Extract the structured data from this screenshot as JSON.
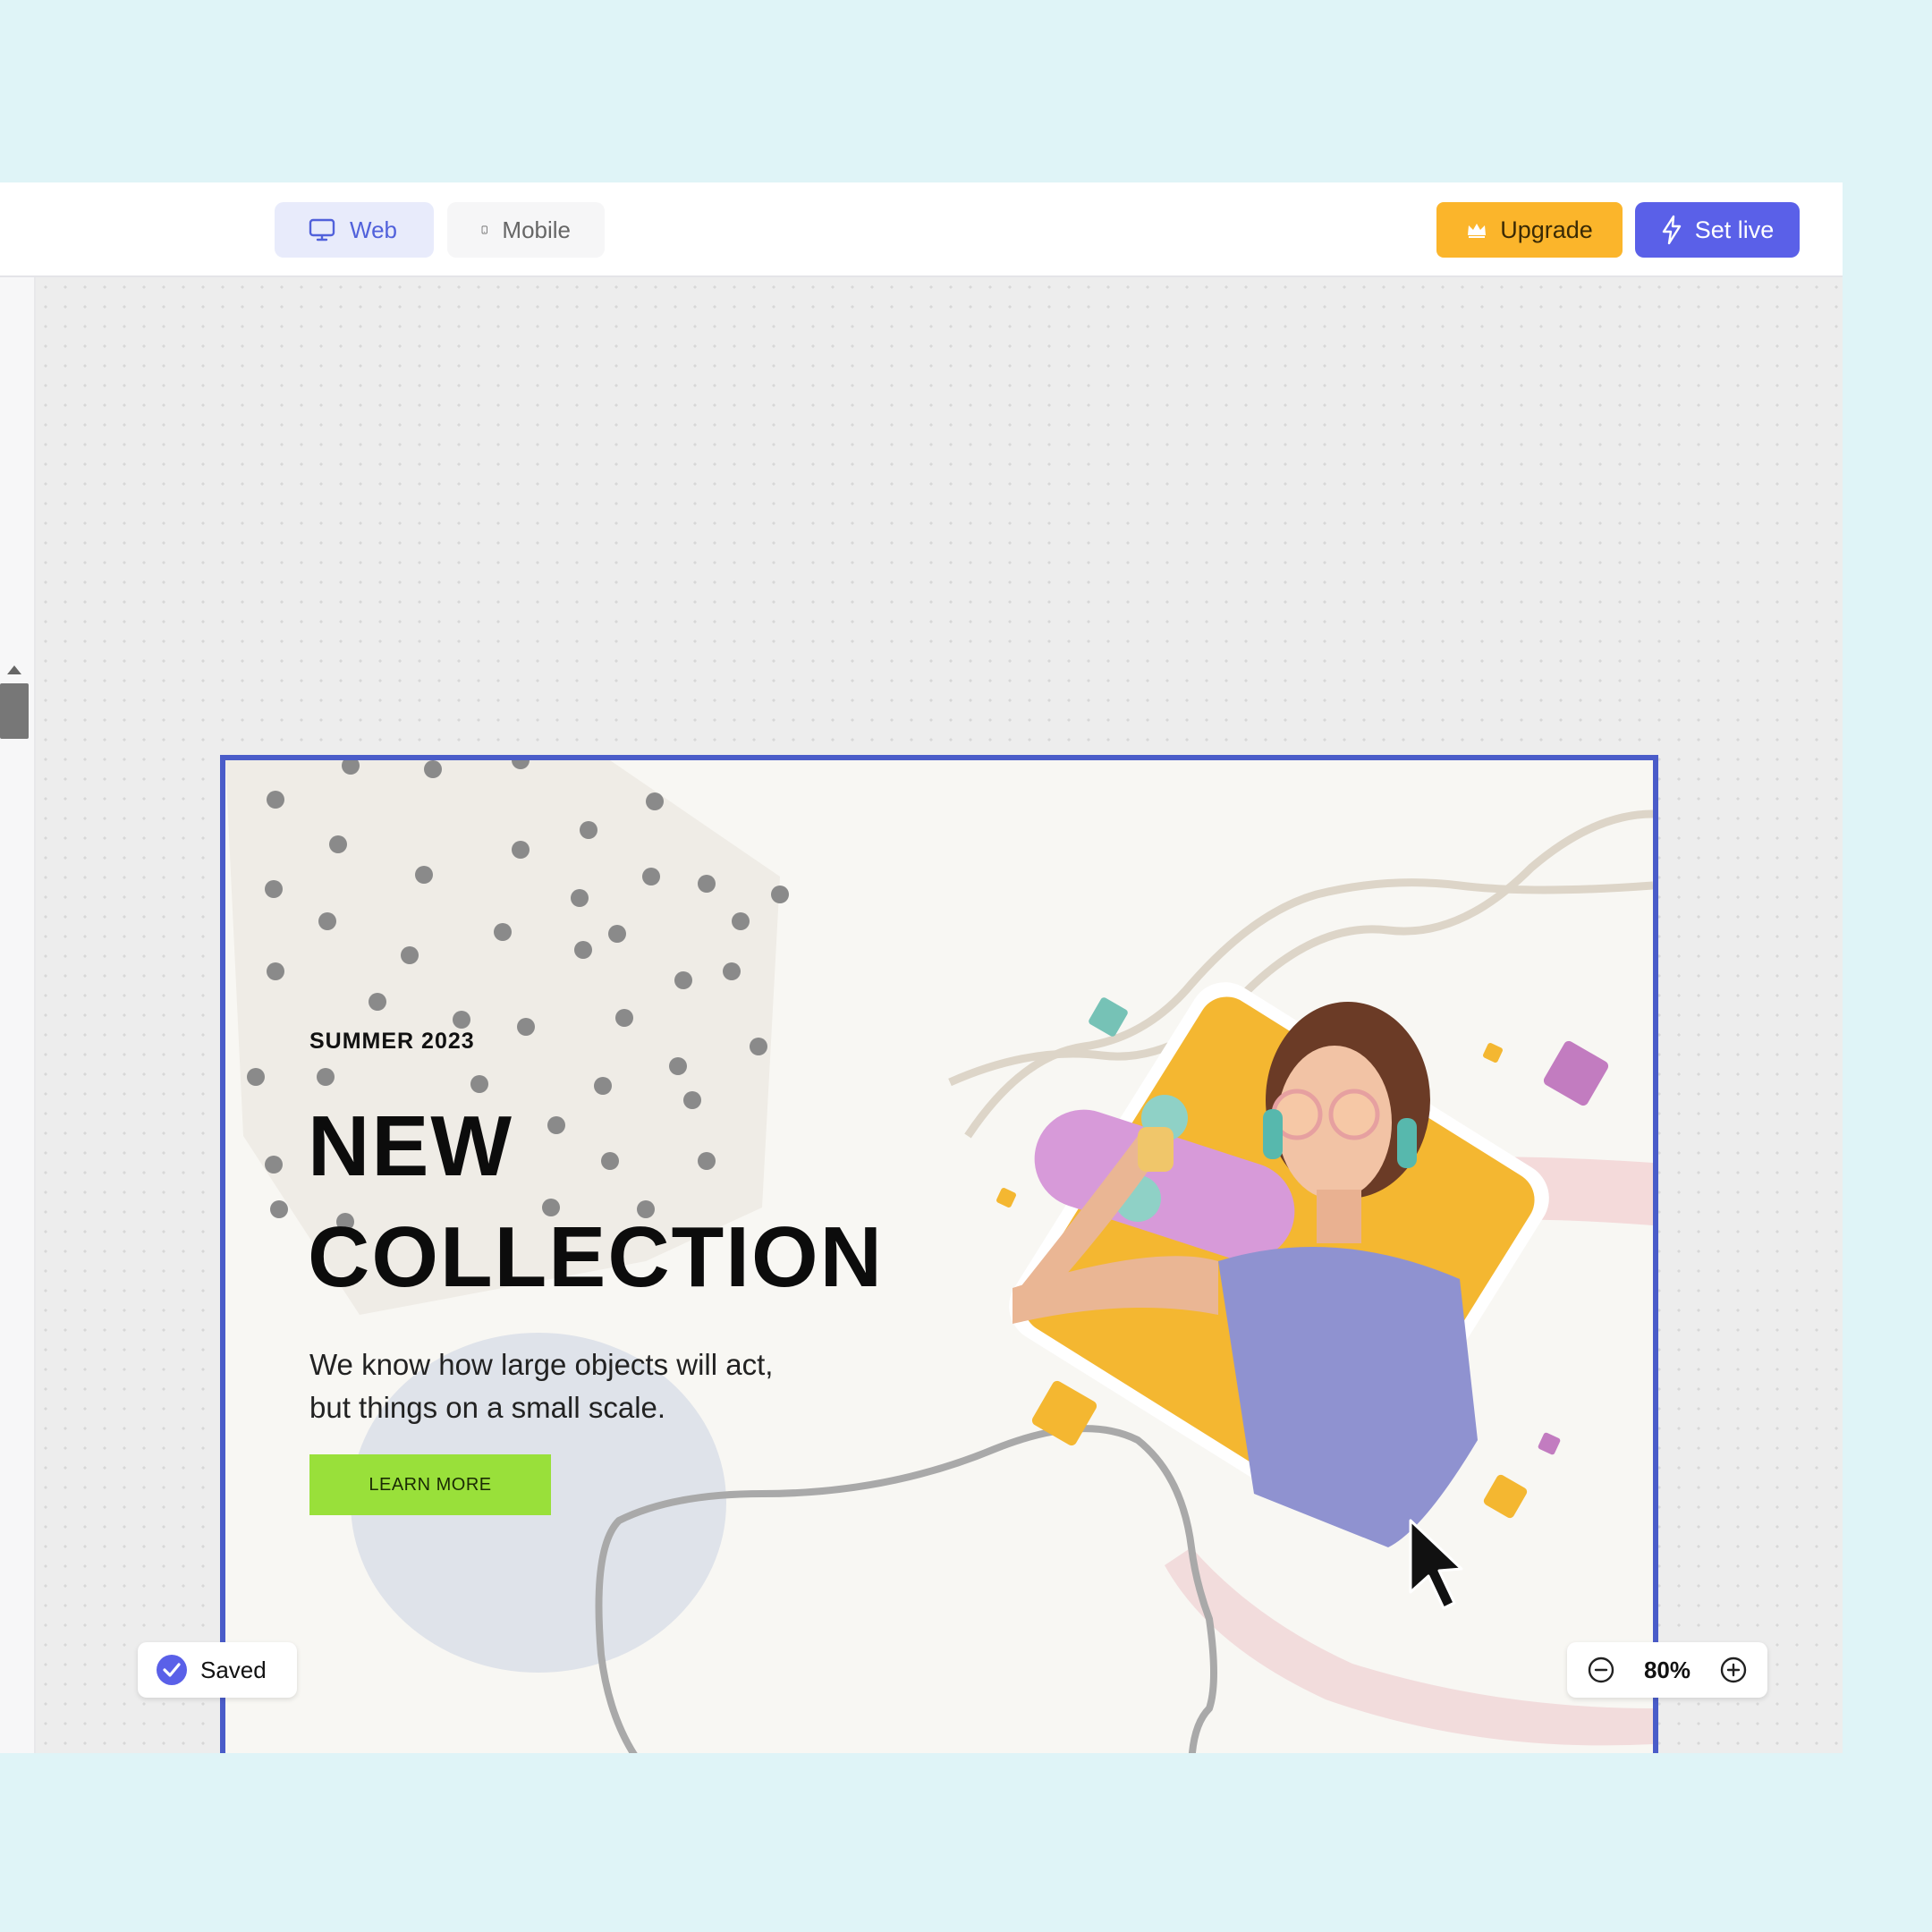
{
  "view_tabs": [
    {
      "label": "Web",
      "icon": "monitor-icon",
      "active": true
    },
    {
      "label": "Mobile",
      "icon": "phone-icon",
      "active": false
    }
  ],
  "actions": {
    "upgrade_label": "Upgrade",
    "upgrade_icon": "crown-icon",
    "set_live_label": "Set live",
    "set_live_icon": "lightning-icon"
  },
  "banner": {
    "eyebrow": "SUMMER 2023",
    "headline_line1": "NEW",
    "headline_line2": "COLLECTION",
    "body_line1": "We know how large objects will act,",
    "body_line2": "but things on a small scale.",
    "cta_label": "LEARN MORE"
  },
  "status": {
    "saved_label": "Saved"
  },
  "zoom": {
    "value": "80%"
  },
  "colors": {
    "accent": "#5a60e8",
    "upgrade": "#fbb52b",
    "selection_border": "#4a5cc9",
    "cta": "#99e03a",
    "photo_backdrop": "#f4b731"
  }
}
